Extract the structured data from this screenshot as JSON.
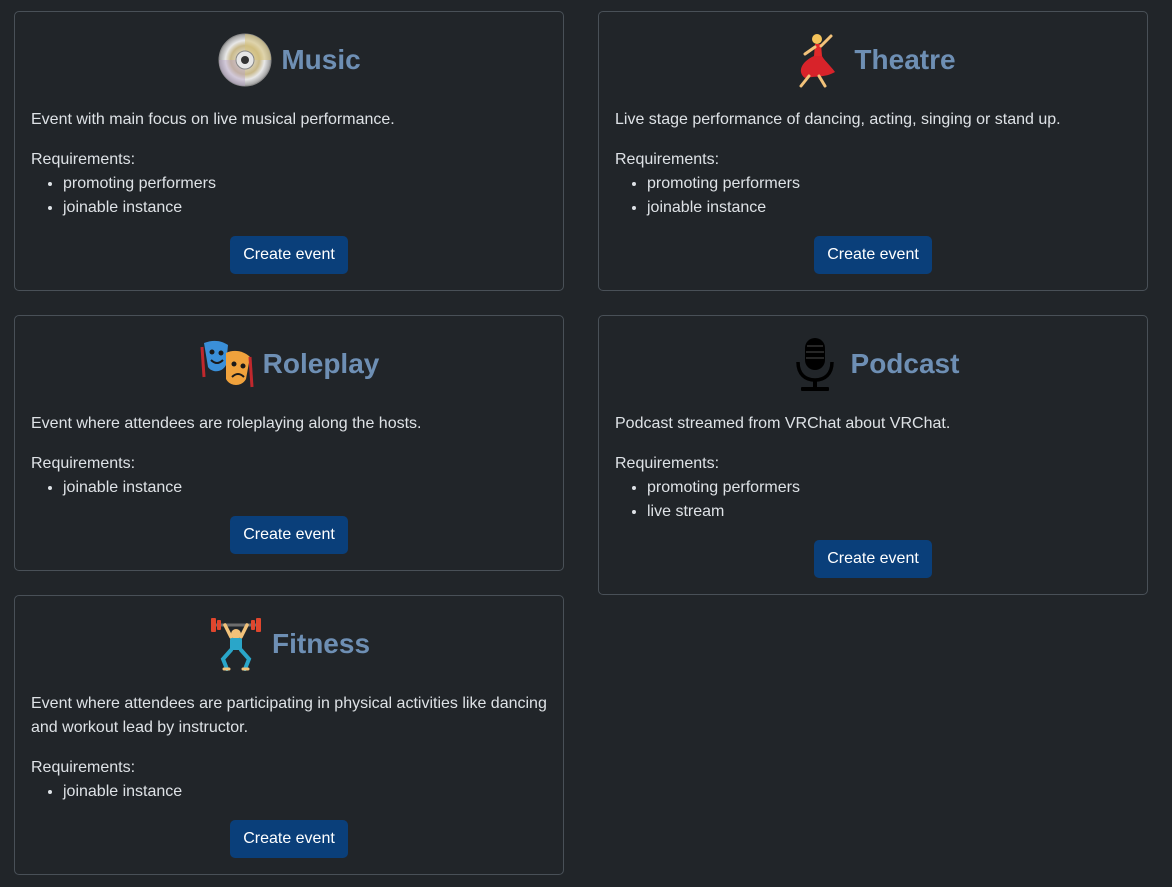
{
  "categories": [
    {
      "title": "Music",
      "icon": "cd-disc-icon",
      "emoji": "💿",
      "description": "Event with main focus on live musical performance.",
      "requirements_label": "Requirements:",
      "requirements": [
        "promoting performers",
        "joinable instance"
      ],
      "button_label": "Create event"
    },
    {
      "title": "Theatre",
      "icon": "dancer-icon",
      "emoji": "💃",
      "description": "Live stage performance of dancing, acting, singing or stand up.",
      "requirements_label": "Requirements:",
      "requirements": [
        "promoting performers",
        "joinable instance"
      ],
      "button_label": "Create event"
    },
    {
      "title": "Roleplay",
      "icon": "theater-masks-icon",
      "emoji": "🎭",
      "description": "Event where attendees are roleplaying along the hosts.",
      "requirements_label": "Requirements:",
      "requirements": [
        "joinable instance"
      ],
      "button_label": "Create event"
    },
    {
      "title": "Podcast",
      "icon": "microphone-icon",
      "emoji": "🎙",
      "description": "Podcast streamed from VRChat about VRChat.",
      "requirements_label": "Requirements:",
      "requirements": [
        "promoting performers",
        "live stream"
      ],
      "button_label": "Create event"
    },
    {
      "title": "Fitness",
      "icon": "weightlifter-icon",
      "emoji": "🏋",
      "description": "Event where attendees are participating in physical activities like dancing and workout lead by instructor.",
      "requirements_label": "Requirements:",
      "requirements": [
        "joinable instance"
      ],
      "button_label": "Create event"
    }
  ],
  "colors": {
    "background": "#212529",
    "card_border": "#495057",
    "title": "#6e8fb4",
    "button": "#0a3f7a",
    "text": "#dee2e6"
  }
}
